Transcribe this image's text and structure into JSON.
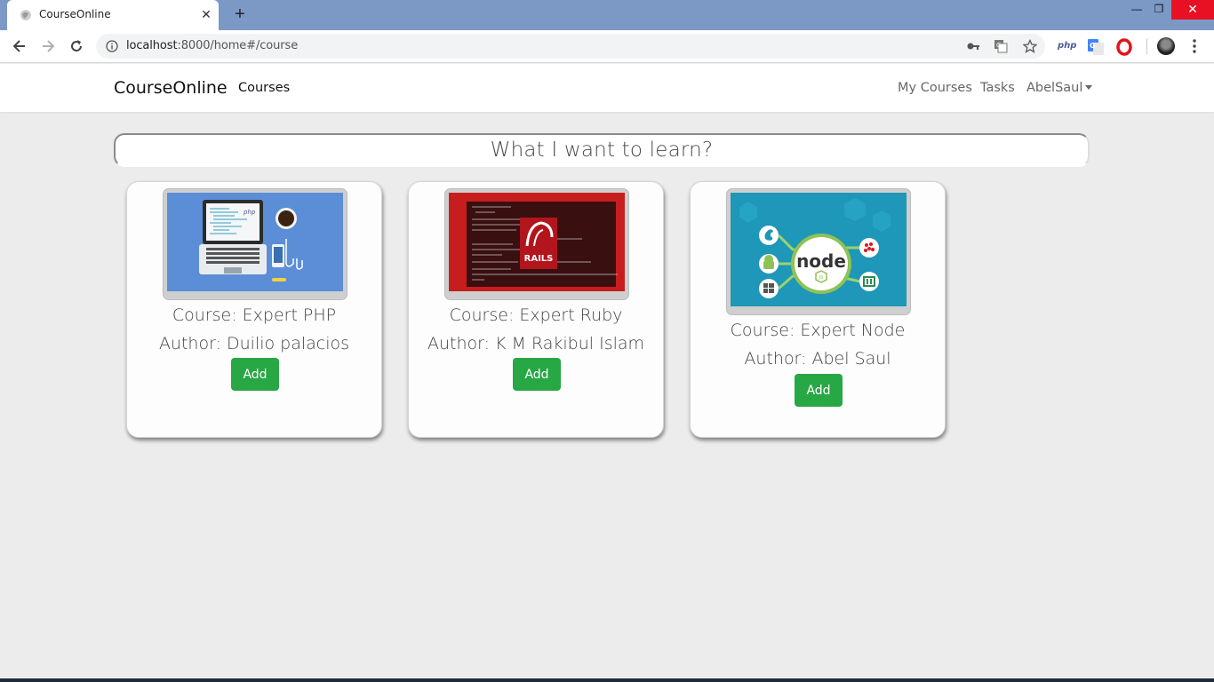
{
  "browser": {
    "tab_title": "CourseOnline",
    "tab_close": "✕",
    "new_tab": "+",
    "url_host": "localhost",
    "url_rest": ":8000/home#/course",
    "ext_php_label": "php",
    "window_controls": {
      "minimize": "—",
      "maximize": "❐",
      "close": "✕"
    }
  },
  "navbar": {
    "brand": "CourseOnline",
    "courses_link": "Courses",
    "my_courses_link": "My Courses",
    "tasks_link": "Tasks",
    "user_menu": "AbelSaul"
  },
  "search": {
    "placeholder": "What I want to learn?"
  },
  "courses": [
    {
      "title": "Course: Expert PHP",
      "author": "Author: Duilio palacios",
      "add_label": "Add",
      "image": "php-laptop-illustration"
    },
    {
      "title": "Course: Expert Ruby",
      "author": "Author: K M Rakibul Islam",
      "add_label": "Add",
      "image": "rails-code-screenshot"
    },
    {
      "title": "Course: Expert Node",
      "author": "Author: Abel Saul",
      "add_label": "Add",
      "image": "node-platforms-diagram"
    }
  ],
  "images": {
    "ruby_logo_text": "RAILS",
    "node_logo_text": "node",
    "node_badge_text": "JS"
  },
  "colors": {
    "accent_green": "#28a745",
    "tabbar": "#7c98c5",
    "page_bg": "#ececec",
    "close_red": "#e81123"
  }
}
